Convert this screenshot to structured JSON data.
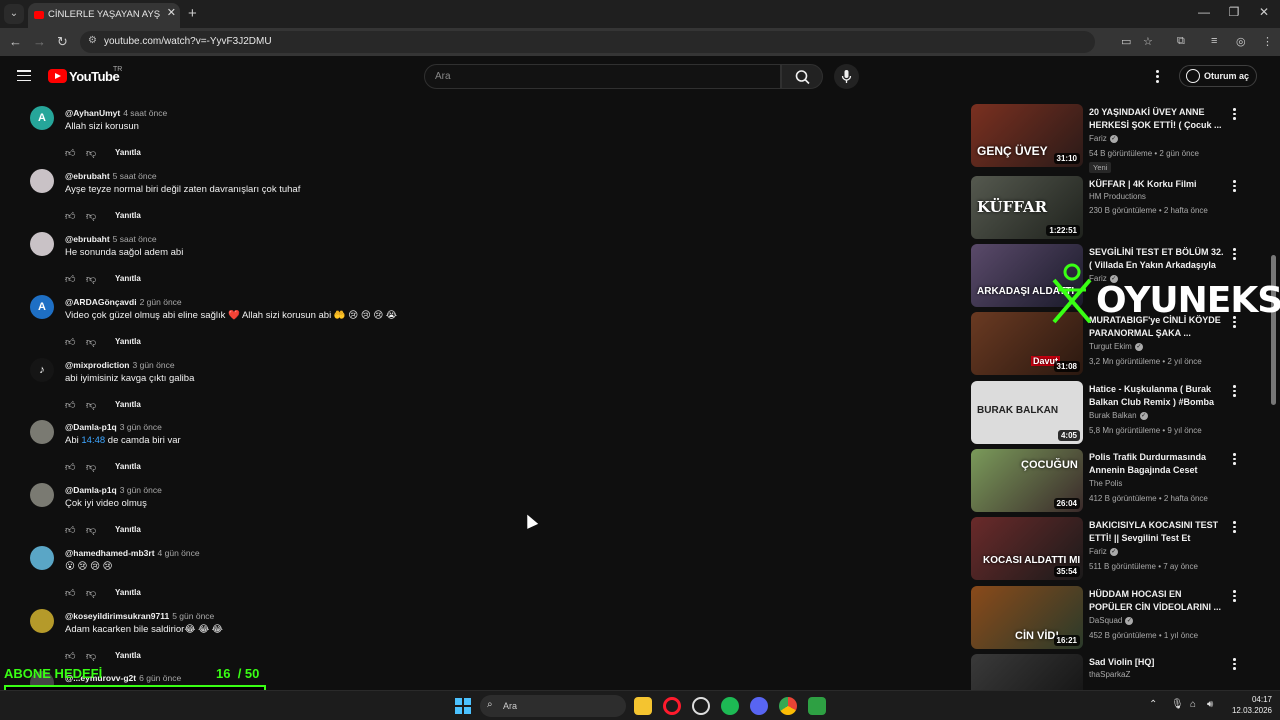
{
  "browser": {
    "tab_title": "CİNLERLE YAŞAYAN AYŞE TEYZE",
    "url": "youtube.com/watch?v=-YyvF3J2DMU"
  },
  "header": {
    "logo_text": "YouTube",
    "region": "TR",
    "search_placeholder": "Ara",
    "signin_label": "Oturum aç"
  },
  "comments": [
    {
      "author": "@AyhanUmyt",
      "time": "4 saat önce",
      "text": "Allah sizi korusun",
      "avatar_letter": "A",
      "avatar_color": "#26a69a",
      "reply": "Yanıtla"
    },
    {
      "author": "@ebrubaht",
      "time": "5 saat önce",
      "text": "Ayşe teyze normal biri değil zaten davranışları çok tuhaf",
      "avatar_letter": "",
      "avatar_color": "#c9c2c6",
      "reply": "Yanıtla"
    },
    {
      "author": "@ebrubaht",
      "time": "5 saat önce",
      "text": "He sonunda sağol adem abi",
      "avatar_letter": "",
      "avatar_color": "#c9c2c6",
      "reply": "Yanıtla"
    },
    {
      "author": "@ARDAGönçavdi",
      "time": "2 gün önce",
      "text": "Video çok güzel olmuş abi eline sağlık ❤️ Allah sizi korusun abi 🤲 😢 😢 😢 😭",
      "avatar_letter": "A",
      "avatar_color": "#1e6fc4",
      "reply": "Yanıtla"
    },
    {
      "author": "@mixprodiction",
      "time": "3 gün önce",
      "text": "abi iyimisiniz kavga çıktı galiba",
      "avatar_letter": "♪",
      "avatar_color": "#151515",
      "reply": "Yanıtla"
    },
    {
      "author": "@Damla-p1q",
      "time": "3 gün önce",
      "text_before": "Abi ",
      "timestamp": "14:48",
      "text_after": " de camda biri var",
      "avatar_letter": "",
      "avatar_color": "#7a7a72",
      "reply": "Yanıtla"
    },
    {
      "author": "@Damla-p1q",
      "time": "3 gün önce",
      "text": "Çok iyi video olmuş",
      "avatar_letter": "",
      "avatar_color": "#7a7a72",
      "reply": "Yanıtla"
    },
    {
      "author": "@hamedhamed-mb3rt",
      "time": "4 gün önce",
      "text": "😮 😢 😢 😢",
      "avatar_letter": "",
      "avatar_color": "#5aa6c6",
      "reply": "Yanıtla"
    },
    {
      "author": "@koseyildirimsukran9711",
      "time": "5 gün önce",
      "text": "Adam kacarken bile saldirior😂 😂 😂",
      "avatar_letter": "",
      "avatar_color": "#b59a2a",
      "reply": "Yanıtla"
    },
    {
      "author": "@...eymurovv-g2t",
      "time": "6 gün önce",
      "text": "",
      "avatar_letter": "",
      "avatar_color": "#444444",
      "reply": ""
    }
  ],
  "recommendations": [
    {
      "title": "20 YAŞINDAKİ ÜVEY ANNE HERKESİ ŞOK ETTİ! ( Çocuk ...",
      "channel": "Fariz",
      "verified": true,
      "meta": "54 B görüntüleme • 2 gün önce",
      "duration": "31:10",
      "badge": "Yeni",
      "thumb_text": "GENÇ ÜVEY",
      "thumb_color": "#5a2a20"
    },
    {
      "title": "KÜFFAR | 4K Korku Filmi",
      "channel": "HM Productions",
      "verified": false,
      "meta": "230 B görüntüleme • 2 hafta önce",
      "duration": "1:22:51",
      "badge": "",
      "thumb_text": "KÜFFAR",
      "thumb_color": "#3c3f38"
    },
    {
      "title": "SEVGİLİNİ TEST ET BÖLÜM 32. ( Villada En Yakın Arkadaşıyla ...",
      "channel": "Fariz",
      "verified": true,
      "meta": "",
      "duration": "",
      "badge": "",
      "thumb_text": "ARKADAŞI ALDATTI",
      "thumb_color": "#3a2d4a"
    },
    {
      "title": "MURATABIGF'ye CİNLİ KÖYDE PARANORMAL ŞAKA ...",
      "channel": "Turgut Ekim",
      "verified": true,
      "meta": "3,2 Mn görüntüleme • 2 yıl önce",
      "duration": "31:08",
      "badge": "",
      "thumb_text": "Davut",
      "thumb_color": "#4a2a1a"
    },
    {
      "title": "Hatice - Kuşkulanma ( Burak Balkan Club Remix ) #Bomba",
      "channel": "Burak Balkan",
      "verified": true,
      "meta": "5,8 Mn görüntüleme • 9 yıl önce",
      "duration": "4:05",
      "badge": "",
      "thumb_text": "BURAK BALKAN",
      "thumb_color": "#d8d8d8"
    },
    {
      "title": "Polis Trafik Durdurmasında Annenin Bagajında Ceset Buldu",
      "channel": "The Polis",
      "verified": false,
      "meta": "412 B görüntüleme • 2 hafta önce",
      "duration": "26:04",
      "badge": "",
      "thumb_text": "ÇOCUĞUN",
      "thumb_color": "#5f7a4a"
    },
    {
      "title": "BAKICISIYLA KOCASINI TEST ETTİ! || Sevgilini Test Et Bölüm...",
      "channel": "Fariz",
      "verified": true,
      "meta": "511 B görüntüleme • 7 ay önce",
      "duration": "35:54",
      "badge": "",
      "thumb_text": "KOCASI ALDATTI MI",
      "thumb_color": "#4a3030"
    },
    {
      "title": "HÜDDAM HOCASI EN POPÜLER CİN VİDEOLARINI ...",
      "channel": "DaSquad",
      "verified": true,
      "meta": "452 B görüntüleme • 1 yıl önce",
      "duration": "16:21",
      "badge": "",
      "thumb_text": "CİN VİD!",
      "thumb_color": "#6a3a1a"
    },
    {
      "title": "Sad Violin [HQ]",
      "channel": "thaSparkaZ",
      "verified": false,
      "meta": "",
      "duration": "",
      "badge": "",
      "thumb_text": "",
      "thumb_color": "#2a2a2a"
    }
  ],
  "overlay": {
    "watermark": "OYUNEKS",
    "sub_goal_label": "ABONE HEDEFİ",
    "sub_goal_count": "16",
    "sub_goal_total": "/ 50",
    "sub_goal_progress": 0.32
  },
  "taskbar": {
    "search_placeholder": "Ara",
    "time": "04:17",
    "date": "12.03.2026"
  }
}
